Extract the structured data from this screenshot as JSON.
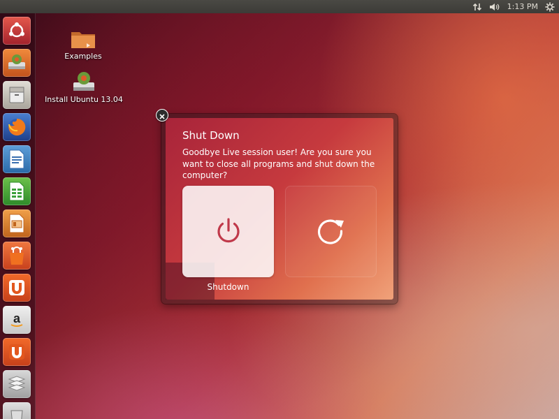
{
  "top_panel": {
    "clock": "1:13 PM",
    "indicators": [
      "network-icon",
      "volume-icon",
      "gear-icon"
    ]
  },
  "launcher": {
    "items": [
      {
        "icon": "dash-home-icon"
      },
      {
        "icon": "install-ubuntu-icon"
      },
      {
        "icon": "files-icon"
      },
      {
        "icon": "firefox-icon"
      },
      {
        "icon": "writer-icon"
      },
      {
        "icon": "calc-icon"
      },
      {
        "icon": "impress-icon"
      },
      {
        "icon": "software-center-icon"
      },
      {
        "icon": "ubuntu-one-icon"
      },
      {
        "icon": "amazon-icon"
      },
      {
        "icon": "ubuntu-one-music-icon"
      },
      {
        "icon": "workspaces-icon"
      }
    ]
  },
  "desktop": {
    "icons": [
      {
        "label": "Examples",
        "icon": "folder-icon"
      },
      {
        "label": "Install Ubuntu 13.04",
        "icon": "install-ubuntu-icon"
      }
    ]
  },
  "dialog": {
    "title": "Shut Down",
    "message": "Goodbye Live session user! Are you sure you want to close all programs and shut down the computer?",
    "shutdown_label": "Shutdown",
    "restart_icon": "restart-icon",
    "shutdown_icon": "power-icon",
    "accent_color": "#c0394a"
  }
}
